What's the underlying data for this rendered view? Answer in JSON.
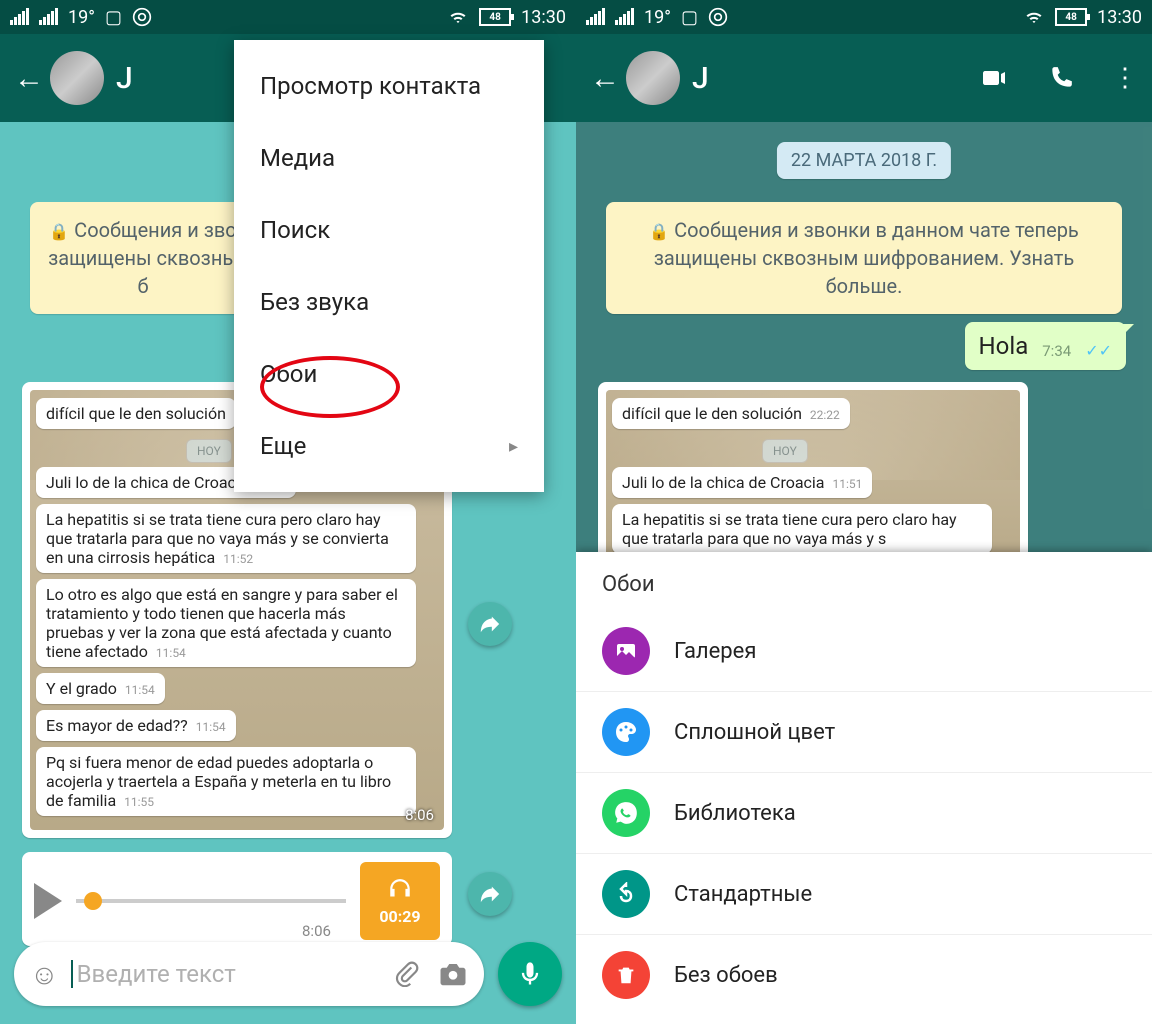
{
  "statusbar": {
    "temp": "19°",
    "battery": "48",
    "time": "13:30"
  },
  "contact": {
    "name": "J"
  },
  "chat": {
    "date": "22 МАРТА 2018 Г.",
    "date_short": "22 М",
    "encryption": "Сообщения и звонки в данном чате теперь защищены сквозным шифрованием. Узнать больше.",
    "encryption_short": "Сообщения и зво\nзащищены сквозны\nб",
    "hola": {
      "text": "Hola",
      "time": "7:34"
    },
    "screenshot": {
      "bubbles": [
        {
          "text": "difícil que le den solución",
          "time": "22:22"
        }
      ],
      "hoy": "HOY",
      "bubbles2": [
        {
          "text": "Juli lo de la chica de Croacia",
          "time": "11:51"
        },
        {
          "text": "La hepatitis si se trata tiene cura pero claro hay que tratarla para que no vaya más y se convierta en una cirrosis hepática",
          "time": "11:52"
        },
        {
          "text": "Lo otro es algo que está en sangre y para saber el tratamiento y todo tienen que hacerla más pruebas y ver la zona que está afectada y cuanto tiene afectado",
          "time": "11:54"
        },
        {
          "text": "Y el grado",
          "time": "11:54"
        },
        {
          "text": "Es mayor de edad??",
          "time": "11:54"
        },
        {
          "text": "Pq si fuera menor de edad puedes adoptarla o acojerla y traertela a España y meterla en tu libro de familia",
          "time": "11:55"
        }
      ],
      "msg_time": "8:06"
    },
    "audio": {
      "time": "8:06",
      "duration": "00:29"
    },
    "input_placeholder": "Введите текст"
  },
  "dropdown": {
    "view_contact": "Просмотр контакта",
    "media": "Медиа",
    "search": "Поиск",
    "mute": "Без звука",
    "wallpaper": "Обои",
    "more": "Еще"
  },
  "sheet": {
    "title": "Обои",
    "gallery": "Галерея",
    "solid": "Сплошной цвет",
    "library": "Библиотека",
    "default": "Стандартные",
    "none": "Без обоев"
  }
}
